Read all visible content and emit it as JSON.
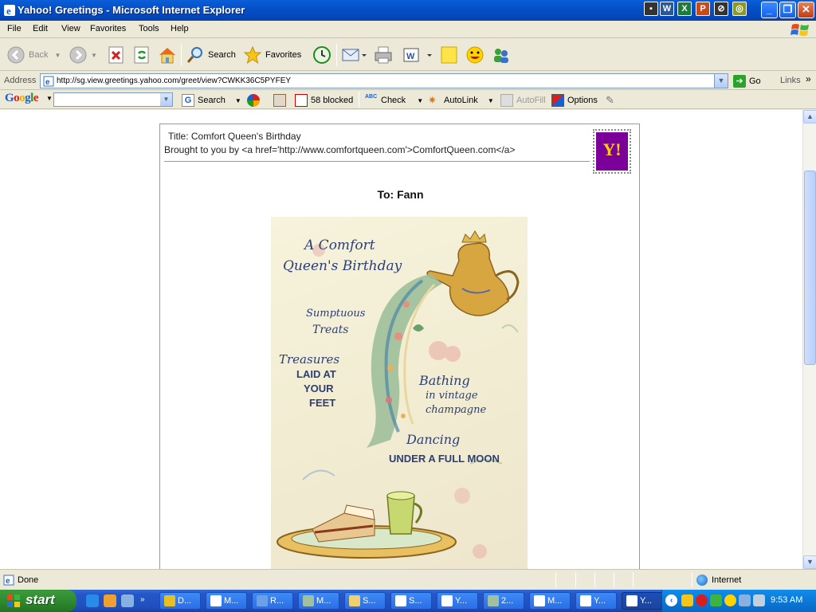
{
  "window": {
    "title": "Yahoo! Greetings - Microsoft Internet Explorer"
  },
  "menu": {
    "items": [
      "File",
      "Edit",
      "View",
      "Favorites",
      "Tools",
      "Help"
    ]
  },
  "toolbar": {
    "back_label": "Back",
    "search_label": "Search",
    "favorites_label": "Favorites"
  },
  "address": {
    "label": "Address",
    "url": "http://sg.view.greetings.yahoo.com/greet/view?CWKK36C5PYFEY",
    "go_label": "Go",
    "links_label": "Links"
  },
  "google_toolbar": {
    "logo": "Google",
    "search_label": "Search",
    "blocked_label": "58 blocked",
    "check_label": "Check",
    "autolink_label": "AutoLink",
    "autofill_label": "AutoFill",
    "options_label": "Options"
  },
  "card": {
    "title": "Title: Comfort Queen's Birthday",
    "brought_by": "Brought to you by <a href='http://www.comfortqueen.com'>ComfortQueen.com</a>",
    "stamp_text": "Y!",
    "to_line": "To: Fann",
    "image_text": {
      "heading_line1": "A Comfort",
      "heading_line2": "Queen's Birthday",
      "sumptuous": "Sumptuous",
      "treats": "Treats",
      "treasures": "Treasures",
      "laid_at": "LAID AT",
      "your": "YOUR",
      "feet": "FEET",
      "bathing": "Bathing",
      "in_vintage": "in vintage",
      "champagne": "champagne",
      "dancing": "Dancing",
      "under_moon": "UNDER A FULL MOON"
    }
  },
  "status": {
    "text": "Done",
    "zone": "Internet"
  },
  "taskbar": {
    "start_label": "start",
    "tasks": [
      {
        "label": "D...",
        "icon_color": "#e8c020"
      },
      {
        "label": "M...",
        "icon_color": "#ffffff"
      },
      {
        "label": "R...",
        "icon_color": "#6aa0e8"
      },
      {
        "label": "M...",
        "icon_color": "#a0c0a0"
      },
      {
        "label": "S...",
        "icon_color": "#f0d070"
      },
      {
        "label": "S...",
        "icon_color": "#ffffff"
      },
      {
        "label": "Y...",
        "icon_color": "#ffffff"
      },
      {
        "label": "2...",
        "icon_color": "#a0c0a0"
      },
      {
        "label": "M...",
        "icon_color": "#ffffff"
      },
      {
        "label": "Y...",
        "icon_color": "#ffffff"
      },
      {
        "label": "Y...",
        "icon_color": "#ffffff"
      }
    ],
    "clock": "9:53 AM"
  },
  "colors": {
    "titlebar": "#0550c8",
    "chrome": "#ece9d8",
    "yahoo_purple": "#7b0099",
    "card_ink": "#2b3e78"
  }
}
